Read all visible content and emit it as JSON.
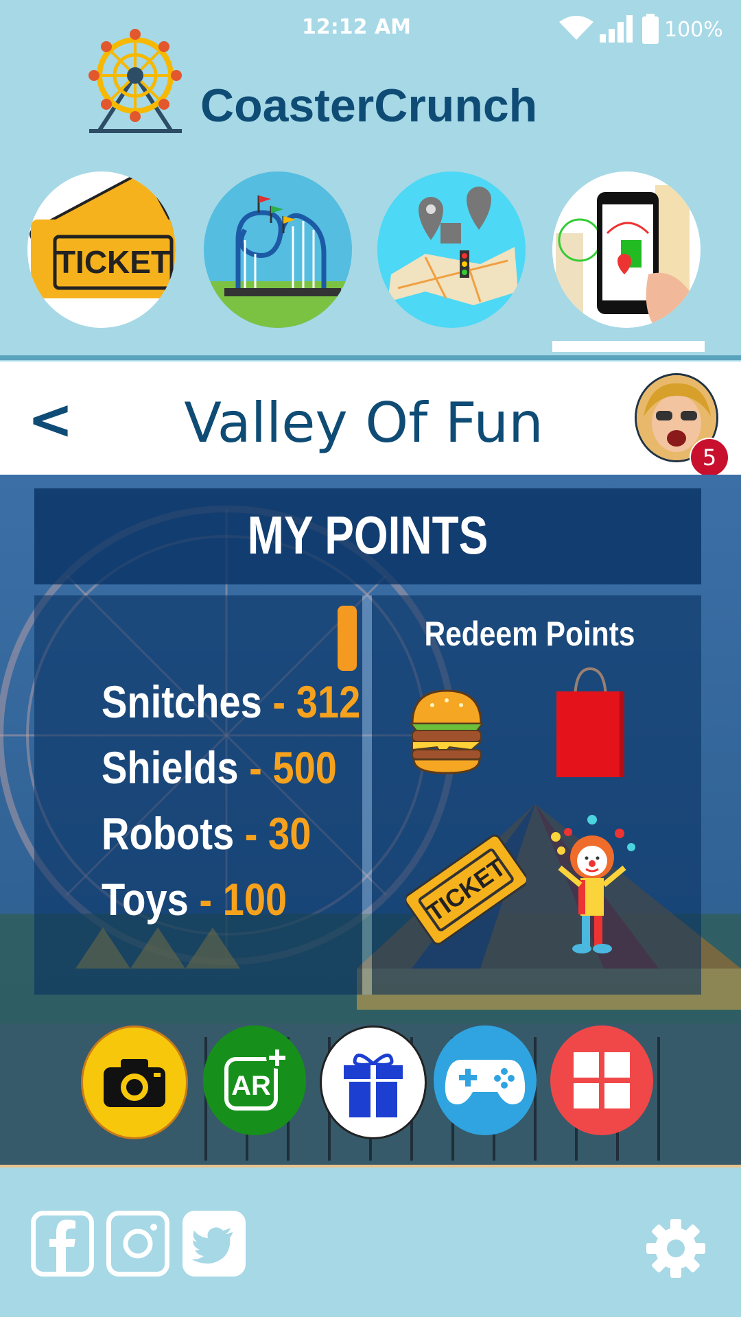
{
  "status_bar": {
    "time": "12:12 AM",
    "battery": "100%"
  },
  "header": {
    "app_title": "CoasterCrunch"
  },
  "nav": {
    "items": [
      {
        "icon": "ticket-icon",
        "label": "TICKET"
      },
      {
        "icon": "roller-coaster-icon"
      },
      {
        "icon": "map-icon"
      },
      {
        "icon": "phone-map-icon"
      }
    ]
  },
  "title_bar": {
    "back": "<",
    "title": "Valley Of Fun",
    "notification_count": "5"
  },
  "points_panel": {
    "heading": "MY POINTS",
    "items": [
      {
        "name": "Snitches",
        "value": "312"
      },
      {
        "name": "Shields",
        "value": "500"
      },
      {
        "name": "Robots",
        "value": "30"
      },
      {
        "name": "Toys",
        "value": "100"
      }
    ],
    "separator": " - ",
    "redeem_title": "Redeem Points",
    "redeem_ticket_label": "TICKET"
  },
  "actions": [
    {
      "icon": "camera-icon",
      "color": "#f7c70b"
    },
    {
      "icon": "ar-plus-icon",
      "label": "AR",
      "color": "#16901a"
    },
    {
      "icon": "gift-icon",
      "color": "#ffffff"
    },
    {
      "icon": "gamepad-icon",
      "color": "#2fa4e0"
    },
    {
      "icon": "grid-icon",
      "color": "#f04848"
    }
  ],
  "footer": {
    "social": [
      "facebook-icon",
      "instagram-icon",
      "twitter-icon"
    ],
    "settings": "gear-icon"
  },
  "colors": {
    "bg": "#a6d8e6",
    "brand": "#0f4c75",
    "accent": "#f7a21d"
  }
}
